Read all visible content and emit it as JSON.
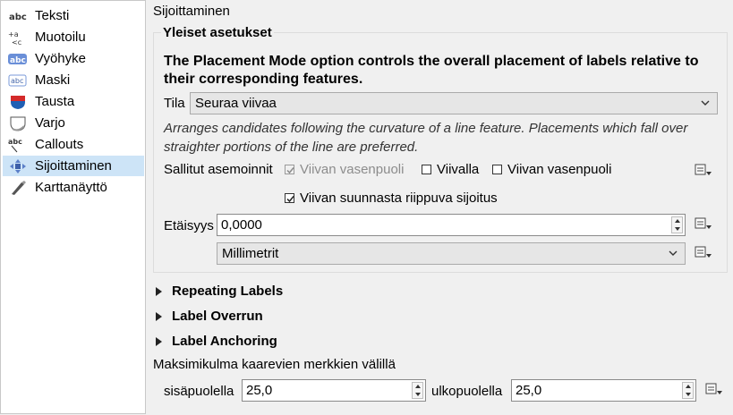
{
  "sidebar": {
    "items": [
      {
        "label": "Teksti",
        "icon": "abc-text-icon",
        "selected": false
      },
      {
        "label": "Muotoilu",
        "icon": "formatting-icon",
        "selected": false
      },
      {
        "label": "Vyöhyke",
        "icon": "buffer-icon",
        "selected": false
      },
      {
        "label": "Maski",
        "icon": "mask-icon",
        "selected": false
      },
      {
        "label": "Tausta",
        "icon": "background-icon",
        "selected": false
      },
      {
        "label": "Varjo",
        "icon": "shadow-icon",
        "selected": false
      },
      {
        "label": "Callouts",
        "icon": "callouts-icon",
        "selected": false
      },
      {
        "label": "Sijoittaminen",
        "icon": "placement-icon",
        "selected": true
      },
      {
        "label": "Karttanäyttö",
        "icon": "rendering-icon",
        "selected": false
      }
    ]
  },
  "section_title": "Sijoittaminen",
  "general": {
    "title": "Yleiset asetukset",
    "description": "The Placement Mode option controls the overall placement of labels relative to their corresponding features.",
    "mode_label": "Tila",
    "mode_value": "Seuraa viivaa",
    "mode_help": "Arranges candidates following the curvature of a line feature. Placements which fall over straighter portions of the line are preferred.",
    "allowed_label": "Sallitut asemoinnit",
    "checkboxes": {
      "left_of_line": {
        "label": "Viivan vasenpuoli",
        "checked": true,
        "disabled": true
      },
      "on_line": {
        "label": "Viivalla",
        "checked": false,
        "disabled": false
      },
      "right_of_line": {
        "label": "Viivan vasenpuoli",
        "checked": false,
        "disabled": false
      },
      "orientation": {
        "label": "Viivan suunnasta riippuva sijoitus",
        "checked": true,
        "disabled": false
      }
    },
    "distance_label": "Etäisyys",
    "distance_value": "0,0000",
    "unit_value": "Millimetrit"
  },
  "collapsibles": [
    "Repeating Labels",
    "Label Overrun",
    "Label Anchoring"
  ],
  "max_angle": {
    "title": "Maksimikulma kaarevien merkkien välillä",
    "inside_label": "sisäpuolella",
    "inside_value": "25,0",
    "outside_label": "ulkopuolella",
    "outside_value": "25,0"
  },
  "colors": {
    "selection": "#cde4f7",
    "panel": "#f0f0f0",
    "define_icon_arrow": "#c8a200"
  }
}
